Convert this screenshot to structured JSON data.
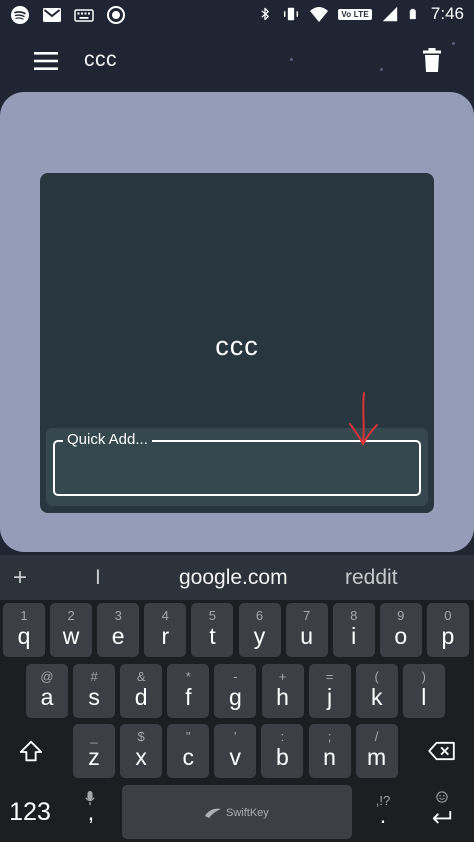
{
  "status_bar": {
    "left_icons": [
      "spotify-icon",
      "gmail-icon",
      "keyboard-icon",
      "record-icon"
    ],
    "network_badge": "Vo LTE",
    "time": "7:46"
  },
  "app_bar": {
    "title": "ccc"
  },
  "card": {
    "title": "ccc",
    "quick_add_placeholder": "Quick Add..."
  },
  "suggestions": {
    "plus": "+",
    "items": [
      "I",
      "google.com",
      "reddit"
    ]
  },
  "keyboard": {
    "row1": [
      {
        "letter": "q",
        "hint": "1"
      },
      {
        "letter": "w",
        "hint": "2"
      },
      {
        "letter": "e",
        "hint": "3"
      },
      {
        "letter": "r",
        "hint": "4"
      },
      {
        "letter": "t",
        "hint": "5"
      },
      {
        "letter": "y",
        "hint": "6"
      },
      {
        "letter": "u",
        "hint": "7"
      },
      {
        "letter": "i",
        "hint": "8"
      },
      {
        "letter": "o",
        "hint": "9"
      },
      {
        "letter": "p",
        "hint": "0"
      }
    ],
    "row2": [
      {
        "letter": "a",
        "hint": "@"
      },
      {
        "letter": "s",
        "hint": "#"
      },
      {
        "letter": "d",
        "hint": "&"
      },
      {
        "letter": "f",
        "hint": "*"
      },
      {
        "letter": "g",
        "hint": "-"
      },
      {
        "letter": "h",
        "hint": "+"
      },
      {
        "letter": "j",
        "hint": "="
      },
      {
        "letter": "k",
        "hint": "("
      },
      {
        "letter": "l",
        "hint": ")"
      }
    ],
    "row3": [
      {
        "letter": "z",
        "hint": "_"
      },
      {
        "letter": "x",
        "hint": "$"
      },
      {
        "letter": "c",
        "hint": "\""
      },
      {
        "letter": "v",
        "hint": "'"
      },
      {
        "letter": "b",
        "hint": ":"
      },
      {
        "letter": "n",
        "hint": ";"
      },
      {
        "letter": "m",
        "hint": "/"
      }
    ],
    "numbers_label": "123",
    "comma": ",",
    "period": ".",
    "period_hint": ",!?",
    "space_brand": "SwiftKey"
  },
  "colors": {
    "background": "#1f2533",
    "board": "#959cb7",
    "card": "#283640",
    "quick_add": "#35484e",
    "key": "#3d3f45",
    "annotation": "#d8323a"
  }
}
